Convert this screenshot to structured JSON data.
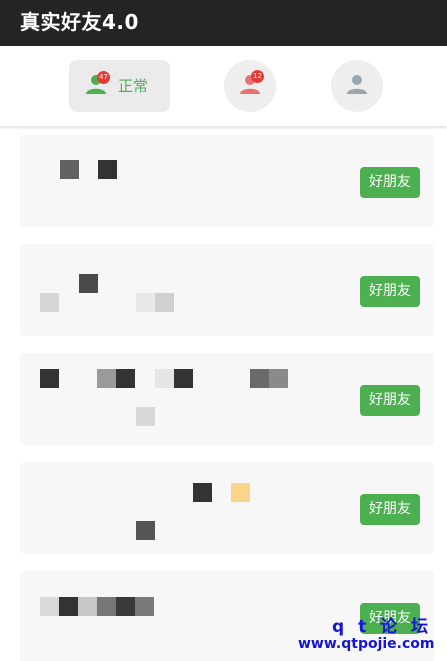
{
  "app": {
    "title": "真实好友4.0"
  },
  "tabs": [
    {
      "label": "正常",
      "badge": "47",
      "color": "#4caf50"
    },
    {
      "label": "",
      "badge": "12",
      "color": "#e57373"
    },
    {
      "label": "",
      "badge": "",
      "color": "#9aa5ad"
    }
  ],
  "friends": [
    {
      "button_label": "好朋友"
    },
    {
      "button_label": "好朋友"
    },
    {
      "button_label": "好朋友"
    },
    {
      "button_label": "好朋友"
    },
    {
      "button_label": "好朋友"
    }
  ],
  "watermark": {
    "line1": "q t 论 坛",
    "line2": "www.qtpojie.com"
  },
  "colors": {
    "accent": "#4caf50",
    "titlebar": "#222426",
    "badge": "#e53935"
  }
}
